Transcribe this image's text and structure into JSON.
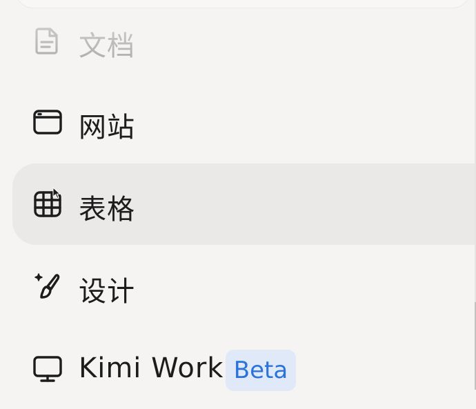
{
  "menu": {
    "items": [
      {
        "label": "文档",
        "icon": "document-icon"
      },
      {
        "label": "网站",
        "icon": "browser-window-icon"
      },
      {
        "label": "表格",
        "icon": "table-grid-icon"
      },
      {
        "label": "设计",
        "icon": "paintbrush-icon"
      },
      {
        "label": "Kimi Work",
        "icon": "monitor-icon",
        "badge": "Beta"
      }
    ]
  },
  "colors": {
    "background": "#f6f4f2",
    "active_item": "#ebe9e7",
    "badge_bg": "#dfe9f7",
    "badge_text": "#2a73d8"
  }
}
